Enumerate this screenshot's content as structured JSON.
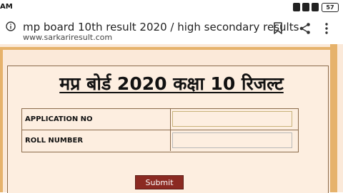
{
  "status_bar": {
    "time": "AM",
    "battery": "57"
  },
  "url_bar": {
    "page_title": "mp board 10th result 2020 / high secondary results",
    "url": "www.sarkariresult.com"
  },
  "page": {
    "heading": "मप्र बोर्ड 2020 कक्षा 10 रिजल्ट",
    "fields": [
      {
        "label": "APPLICATION NO",
        "value": ""
      },
      {
        "label": "ROLL NUMBER",
        "value": ""
      }
    ],
    "submit_label": "Submit"
  },
  "colors": {
    "page_background": "#fbe9d9",
    "frame": "#e6b26b",
    "submit_button": "#8b2a22"
  }
}
